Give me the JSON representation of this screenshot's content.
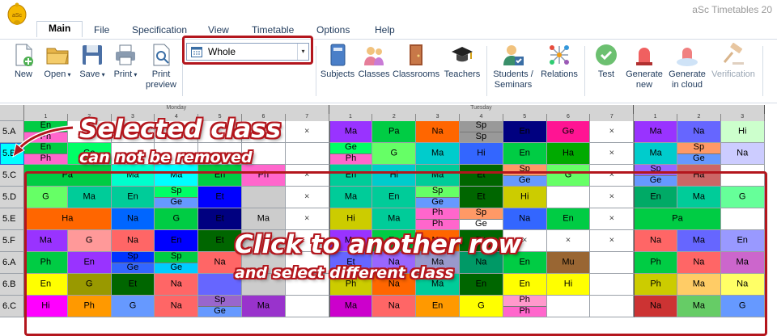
{
  "app": {
    "title": "aSc Timetables 20",
    "logo": "bell-logo-icon"
  },
  "menu": [
    {
      "label": "Main",
      "active": true
    },
    {
      "label": "File"
    },
    {
      "label": "Specification"
    },
    {
      "label": "View"
    },
    {
      "label": "Timetable"
    },
    {
      "label": "Options"
    },
    {
      "label": "Help"
    }
  ],
  "ribbon": {
    "new": "New",
    "open": "Open",
    "save": "Save",
    "print": "Print",
    "print_preview_1": "Print",
    "print_preview_2": "preview",
    "view_selector": "Whole",
    "subjects": "Subjects",
    "classes": "Classes",
    "classrooms": "Classrooms",
    "teachers": "Teachers",
    "students_1": "Students /",
    "students_2": "Seminars",
    "relations": "Relations",
    "test": "Test",
    "generate_new_1": "Generate",
    "generate_new_2": "new",
    "generate_cloud_1": "Generate",
    "generate_cloud_2": "in cloud",
    "verification": "Verification"
  },
  "days": [
    "Monday",
    "Tuesday"
  ],
  "periods": [
    "1",
    "2",
    "3",
    "4",
    "5",
    "6",
    "7"
  ],
  "rows": [
    {
      "name": "5.A",
      "cells": [
        {
          "s": "En",
          "b": "Ph",
          "c": "#00cc44",
          "c2": "#ff66cc"
        },
        {
          "t": "",
          "c": "#ffffff"
        },
        {
          "t": "",
          "c": "#ffffff"
        },
        {
          "t": "",
          "c": "#ffffff"
        },
        {
          "t": "",
          "c": "#ffffff"
        },
        {
          "t": "",
          "c": "#ffffff"
        },
        {
          "t": "×",
          "c": "#ffffff"
        },
        {
          "t": "Ma",
          "c": "#9933ff"
        },
        {
          "t": "Pa",
          "c": "#00cc44"
        },
        {
          "t": "Na",
          "c": "#ff6600"
        },
        {
          "s": "Sp",
          "b": "Sp",
          "c": "#999999",
          "c2": "#999999"
        },
        {
          "t": "En",
          "c": "#000080"
        },
        {
          "t": "Ge",
          "c": "#ff1493"
        },
        {
          "t": "×",
          "c": "#ffffff"
        },
        {
          "t": "Ma",
          "c": "#9933ff"
        },
        {
          "t": "Na",
          "c": "#6666ff"
        },
        {
          "t": "Hi",
          "c": "#ccffcc"
        }
      ]
    },
    {
      "name": "5.B",
      "cells": [
        {
          "s": "En",
          "b": "Ph",
          "c": "#00cc44",
          "c2": "#ff66cc"
        },
        {
          "t": "Ge",
          "c": "#00ff66"
        },
        {
          "t": "",
          "c": "#ffffff"
        },
        {
          "t": "",
          "c": "#ffffff"
        },
        {
          "t": "",
          "c": "#ffffff"
        },
        {
          "t": "",
          "c": "#ffffff"
        },
        {
          "t": "",
          "c": "#ffffff"
        },
        {
          "s": "Ge",
          "b": "Ph",
          "c": "#00ff66",
          "c2": "#ff66cc"
        },
        {
          "t": "G",
          "c": "#66ff66"
        },
        {
          "t": "Ma",
          "c": "#00cccc"
        },
        {
          "t": "Hi",
          "c": "#3366ff"
        },
        {
          "t": "En",
          "c": "#00cc44"
        },
        {
          "t": "Ha",
          "c": "#00aa00"
        },
        {
          "t": "×",
          "c": "#ffffff"
        },
        {
          "t": "Ma",
          "c": "#00cccc"
        },
        {
          "s": "Sp",
          "b": "Ge",
          "c": "#ff9966",
          "c2": "#6699ff"
        },
        {
          "t": "Na",
          "c": "#ccccff"
        }
      ]
    },
    {
      "name": "5.C",
      "cells": [
        {
          "t": "Pa",
          "c": "#00cc44",
          "span": 2
        },
        {
          "t": "",
          "c": "#00cc44",
          "skip": true
        },
        {
          "t": "Ma",
          "c": "#00ffcc"
        },
        {
          "t": "Ma",
          "c": "#00ffff"
        },
        {
          "t": "En",
          "c": "#00cc44"
        },
        {
          "t": "Ph",
          "c": "#ff66cc"
        },
        {
          "t": "×",
          "c": "#ffffff"
        },
        {
          "t": "En",
          "c": "#00cc99"
        },
        {
          "t": "Hi",
          "c": "#00cccc"
        },
        {
          "t": "Ma",
          "c": "#00cc99"
        },
        {
          "t": "Et",
          "c": "#006600"
        },
        {
          "s": "Sp",
          "b": "Ge",
          "c": "#ff9966",
          "c2": "#6699ff"
        },
        {
          "t": "G",
          "c": "#66ff66"
        },
        {
          "t": "×",
          "c": "#ffffff"
        },
        {
          "s": "Sp",
          "b": "Ge",
          "c": "#9966ff",
          "c2": "#6699ff"
        },
        {
          "t": "Ha",
          "c": "#cc6666"
        },
        {
          "t": "",
          "c": "#ffffff"
        }
      ]
    },
    {
      "name": "5.D",
      "cells": [
        {
          "t": "G",
          "c": "#66ff66"
        },
        {
          "t": "Ma",
          "c": "#00cc99"
        },
        {
          "t": "En",
          "c": "#00cc99"
        },
        {
          "s": "Sp",
          "b": "Ge",
          "c": "#00ff66",
          "c2": "#6699ff"
        },
        {
          "t": "Et",
          "c": "#0000ff"
        },
        {
          "t": "",
          "c": "#cccccc"
        },
        {
          "t": "×",
          "c": "#ffffff"
        },
        {
          "t": "Ma",
          "c": "#00cc99"
        },
        {
          "t": "En",
          "c": "#00cc99"
        },
        {
          "s": "Sp",
          "b": "Ge",
          "c": "#66ff66",
          "c2": "#6699ff"
        },
        {
          "t": "Et",
          "c": "#006600"
        },
        {
          "t": "Hi",
          "c": "#cccc00"
        },
        {
          "t": "",
          "c": "#ffffff"
        },
        {
          "t": "×",
          "c": "#ffffff"
        },
        {
          "t": "En",
          "c": "#00aa66"
        },
        {
          "t": "Ma",
          "c": "#00cc99"
        },
        {
          "t": "G",
          "c": "#66ff99"
        }
      ]
    },
    {
      "name": "5.E",
      "cells": [
        {
          "t": "Ha",
          "c": "#ff6600",
          "span": 2
        },
        {
          "t": "",
          "c": "#ff6600",
          "skip": true
        },
        {
          "t": "Na",
          "c": "#0066ff"
        },
        {
          "t": "G",
          "c": "#00cc44"
        },
        {
          "t": "Et",
          "c": "#000080"
        },
        {
          "t": "Ma",
          "c": "#cccccc"
        },
        {
          "t": "×",
          "c": "#ffffff"
        },
        {
          "t": "Hi",
          "c": "#cccc00"
        },
        {
          "t": "Ma",
          "c": "#00cc99"
        },
        {
          "s": "Ph",
          "b": "Ph",
          "c": "#ff66cc",
          "c2": "#ff66cc"
        },
        {
          "s": "Sp",
          "b": "Ge",
          "c": "#ff9966",
          "c2": "#ffffff"
        },
        {
          "t": "Na",
          "c": "#3366ff"
        },
        {
          "t": "En",
          "c": "#00cc44"
        },
        {
          "t": "×",
          "c": "#ffffff"
        },
        {
          "t": "Pa",
          "c": "#00cc44",
          "span": 2
        },
        {
          "t": "",
          "c": "#00cc44",
          "skip": true
        },
        {
          "t": "",
          "c": "#ffffff"
        }
      ]
    },
    {
      "name": "5.F",
      "cells": [
        {
          "t": "Ma",
          "c": "#9933ff"
        },
        {
          "t": "G",
          "c": "#ff9999"
        },
        {
          "t": "Na",
          "c": "#ff6666"
        },
        {
          "t": "En",
          "c": "#0000ff"
        },
        {
          "t": "Et",
          "c": "#006600"
        },
        {
          "t": "",
          "c": "#cccccc"
        },
        {
          "t": "",
          "c": "#ffffff"
        },
        {
          "t": "Ma",
          "c": "#9933ff"
        },
        {
          "t": "En",
          "c": "#00cc44"
        },
        {
          "t": "Na",
          "c": "#ff6600"
        },
        {
          "t": "En",
          "c": "#006600"
        },
        {
          "t": "×",
          "c": "#ffffff"
        },
        {
          "t": "×",
          "c": "#ffffff"
        },
        {
          "t": "×",
          "c": "#ffffff"
        },
        {
          "t": "Na",
          "c": "#ff6666"
        },
        {
          "t": "Ma",
          "c": "#6666ff"
        },
        {
          "t": "En",
          "c": "#9999ff"
        }
      ]
    },
    {
      "name": "6.A",
      "cells": [
        {
          "t": "Ph",
          "c": "#00cc44"
        },
        {
          "t": "En",
          "c": "#9933ff"
        },
        {
          "s": "Sp",
          "b": "Ge",
          "c": "#0033ff",
          "c2": "#3366ff"
        },
        {
          "s": "Sp",
          "b": "Ge",
          "c": "#00cc44",
          "c2": "#00ccff"
        },
        {
          "t": "Na",
          "c": "#ff6666"
        },
        {
          "t": "",
          "c": "#cccccc"
        },
        {
          "t": "",
          "c": "#ffffff"
        },
        {
          "t": "Et",
          "c": "#6666ff"
        },
        {
          "t": "Na",
          "c": "#9966ff"
        },
        {
          "t": "Ma",
          "c": "#9999cc"
        },
        {
          "t": "Na",
          "c": "#009966"
        },
        {
          "t": "En",
          "c": "#00cc44"
        },
        {
          "t": "Mu",
          "c": "#996633"
        },
        {
          "t": "",
          "c": "#ffffff"
        },
        {
          "t": "Ph",
          "c": "#00cc44"
        },
        {
          "t": "Na",
          "c": "#ff6666"
        },
        {
          "t": "Ma",
          "c": "#cc66cc"
        }
      ]
    },
    {
      "name": "6.B",
      "cells": [
        {
          "t": "En",
          "c": "#ffff00"
        },
        {
          "t": "G",
          "c": "#999900"
        },
        {
          "t": "Et",
          "c": "#006600"
        },
        {
          "t": "Na",
          "c": "#ff6666"
        },
        {
          "t": "",
          "c": "#6666ff"
        },
        {
          "t": "",
          "c": "#cccccc"
        },
        {
          "t": "",
          "c": "#ffffff"
        },
        {
          "t": "Ph",
          "c": "#cccc00"
        },
        {
          "t": "Na",
          "c": "#ff6600"
        },
        {
          "t": "Ma",
          "c": "#00cc99"
        },
        {
          "t": "En",
          "c": "#006600"
        },
        {
          "t": "En",
          "c": "#ffff00"
        },
        {
          "t": "Hi",
          "c": "#ffff00"
        },
        {
          "t": "",
          "c": "#ffffff"
        },
        {
          "t": "Ph",
          "c": "#cccc00"
        },
        {
          "t": "Ma",
          "c": "#ffcc66"
        },
        {
          "t": "Na",
          "c": "#ffff66"
        }
      ]
    },
    {
      "name": "6.C",
      "cells": [
        {
          "t": "Hi",
          "c": "#ff00ff"
        },
        {
          "t": "Ph",
          "c": "#ff9900"
        },
        {
          "t": "G",
          "c": "#6699ff"
        },
        {
          "t": "Na",
          "c": "#ff6666"
        },
        {
          "s": "Sp",
          "b": "Ge",
          "c": "#9966cc",
          "c2": "#6699ff"
        },
        {
          "t": "Ma",
          "c": "#9933cc"
        },
        {
          "t": "",
          "c": "#ffffff"
        },
        {
          "t": "Ma",
          "c": "#cc00cc"
        },
        {
          "t": "Na",
          "c": "#ff6666"
        },
        {
          "t": "En",
          "c": "#ff9900"
        },
        {
          "t": "G",
          "c": "#ffff00"
        },
        {
          "s": "Ph",
          "b": "Ph",
          "c": "#ff99cc",
          "c2": "#ff66cc"
        },
        {
          "t": "",
          "c": "#ffffff"
        },
        {
          "t": "",
          "c": "#ffffff"
        },
        {
          "t": "Na",
          "c": "#cc3333"
        },
        {
          "t": "Ma",
          "c": "#66cc66"
        },
        {
          "t": "G",
          "c": "#6699ff"
        }
      ]
    }
  ],
  "annotations": {
    "selected_title": "Selected class",
    "selected_sub": "can not be removed",
    "click_title": "Click to another row",
    "click_sub": "and select different class"
  }
}
